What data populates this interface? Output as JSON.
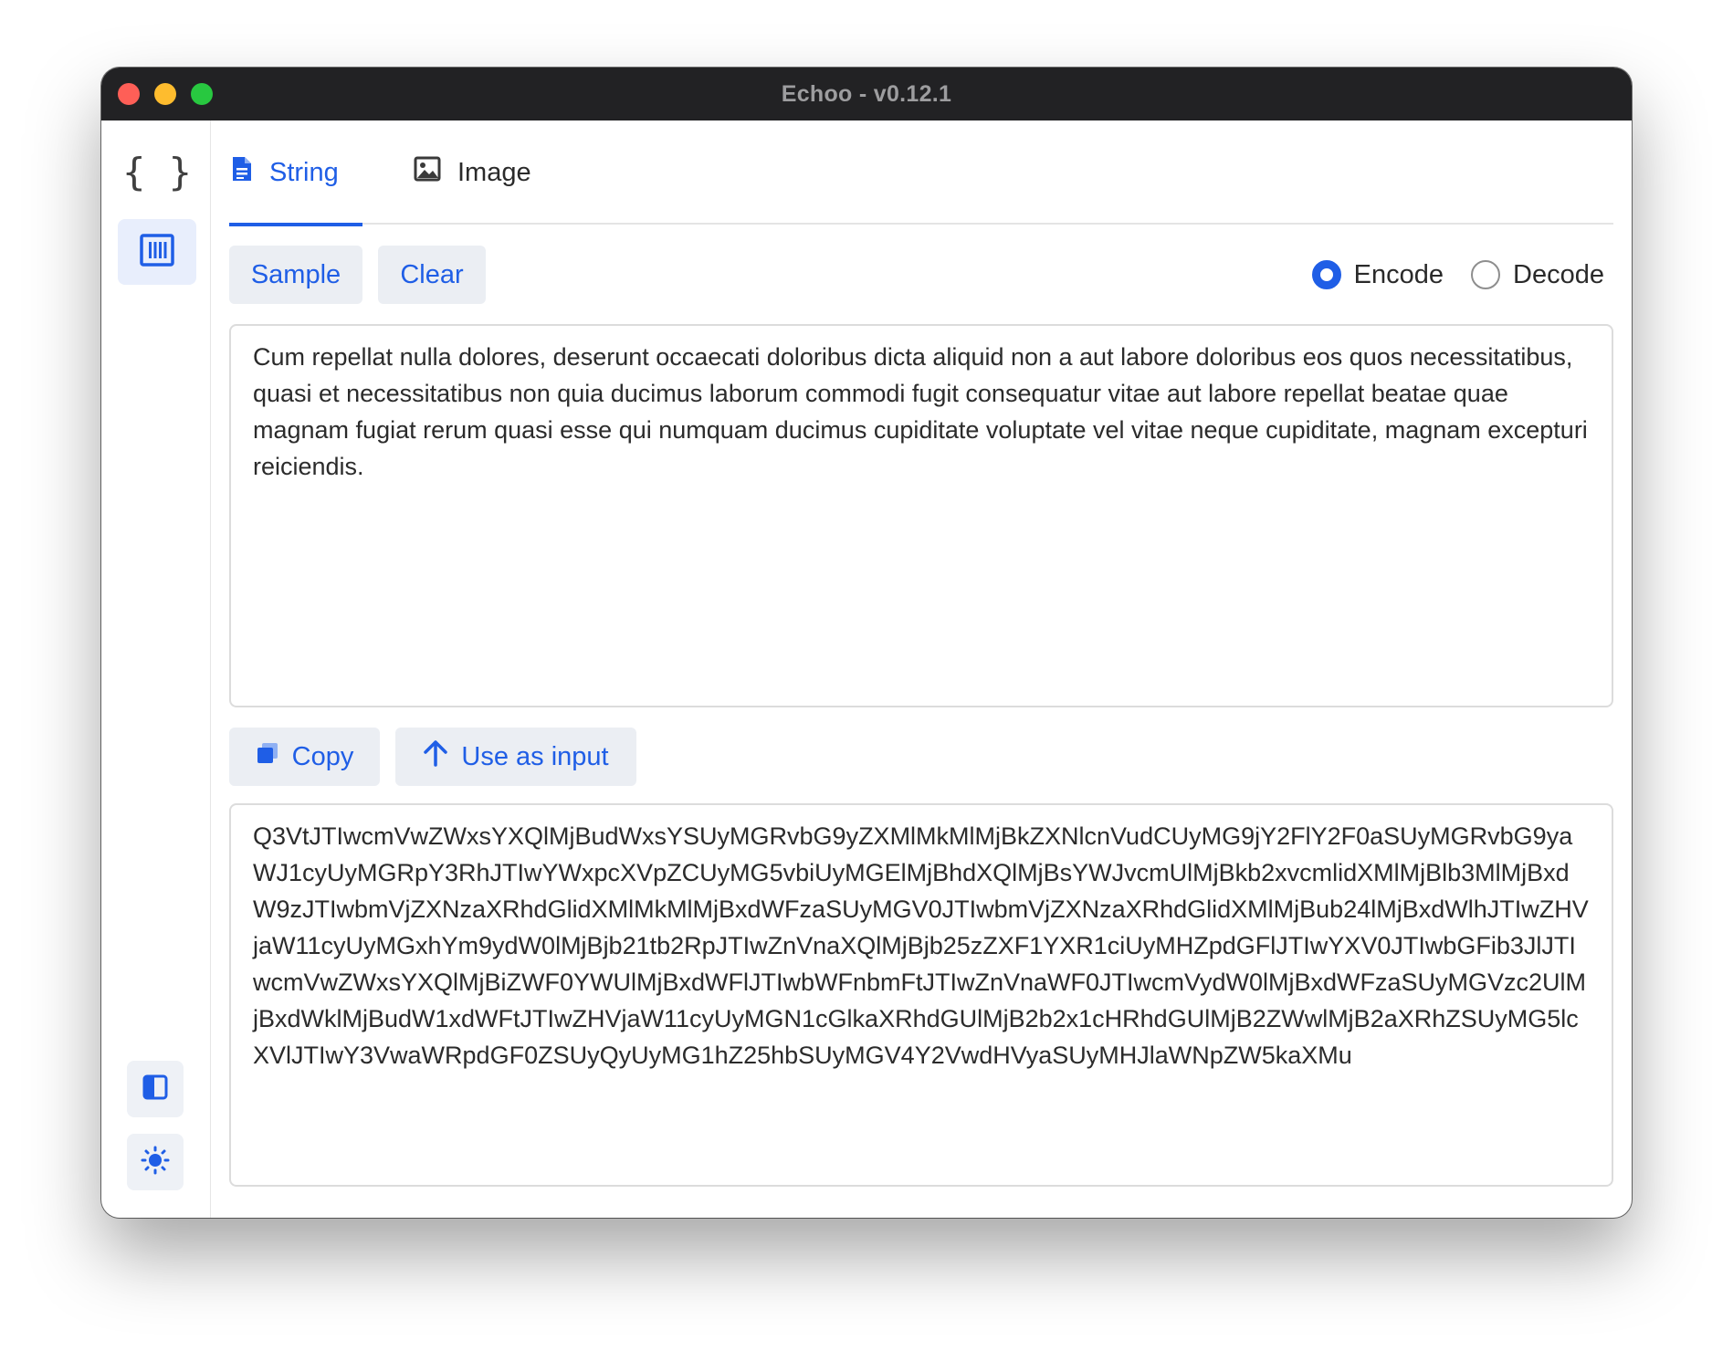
{
  "window": {
    "title": "Echoo - v0.12.1"
  },
  "sidebar": {
    "items": [
      {
        "name": "json-tool",
        "icon": "braces-icon",
        "glyph": "{ }"
      },
      {
        "name": "encoder-tool",
        "icon": "barcode-icon",
        "active": true
      }
    ],
    "bottom": [
      {
        "name": "layout-toggle",
        "icon": "sidebar-layout-icon"
      },
      {
        "name": "theme-toggle",
        "icon": "sun-icon"
      }
    ]
  },
  "tabs": [
    {
      "label": "String",
      "icon": "document-icon",
      "active": true
    },
    {
      "label": "Image",
      "icon": "image-icon",
      "active": false
    }
  ],
  "toolbar": {
    "sample_label": "Sample",
    "clear_label": "Clear"
  },
  "mode": {
    "encode_label": "Encode",
    "decode_label": "Decode",
    "selected": "Encode"
  },
  "input": {
    "value": "Cum repellat nulla dolores, deserunt occaecati doloribus dicta aliquid non a aut labore doloribus eos quos necessitatibus, quasi et necessitatibus non quia ducimus laborum commodi fugit consequatur vitae aut labore repellat beatae quae magnam fugiat rerum quasi esse qui numquam ducimus cupiditate voluptate vel vitae neque cupiditate, magnam excepturi reiciendis."
  },
  "output_actions": {
    "copy_label": "Copy",
    "use_label": "Use as input"
  },
  "output": {
    "value": "Q3VtJTIwcmVwZWxsYXQlMjBudWxsYSUyMGRvbG9yZXMlMkMlMjBkZXNlcnVudCUyMG9jY2FlY2F0aSUyMGRvbG9yaWJ1cyUyMGRpY3RhJTIwYWxpcXVpZCUyMG5vbiUyMGElMjBhdXQlMjBsYWJvcmUlMjBkb2xvcmlidXMlMjBlb3MlMjBxdW9zJTIwbmVjZXNzaXRhdGlidXMlMkMlMjBxdWFzaSUyMGV0JTIwbmVjZXNzaXRhdGlidXMlMjBub24lMjBxdWlhJTIwZHVjaW11cyUyMGxhYm9ydW0lMjBjb21tb2RpJTIwZnVnaXQlMjBjb25zZXF1YXR1ciUyMHZpdGFlJTIwYXV0JTIwbGFib3JlJTIwcmVwZWxsYXQlMjBiZWF0YWUlMjBxdWFlJTIwbWFnbmFtJTIwZnVnaWF0JTIwcmVydW0lMjBxdWFzaSUyMGVzc2UlMjBxdWklMjBudW1xdWFtJTIwZHVjaW11cyUyMGN1cGlkaXRhdGUlMjB2b2x1cHRhdGUlMjB2ZWwlMjB2aXRhZSUyMG5lcXVlJTIwY3VwaWRpdGF0ZSUyQyUyMG1hZ25hbSUyMGV4Y2VwdHVyaSUyMHJlaWNpZW5kaXMu"
  },
  "colors": {
    "accent": "#1f5ee6",
    "titlebar": "#222224"
  }
}
